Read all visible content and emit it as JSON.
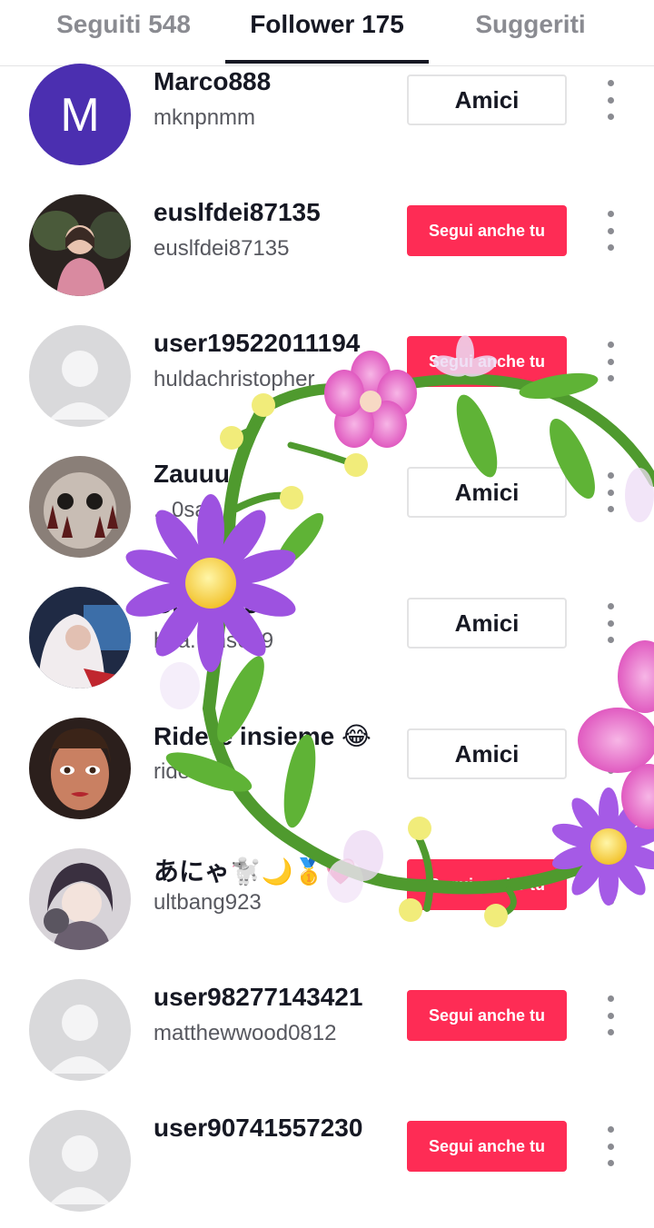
{
  "tabs": [
    {
      "label": "Seguiti 548"
    },
    {
      "label": "Follower 175"
    },
    {
      "label": "Suggeriti"
    }
  ],
  "followers": [
    {
      "name": "Marco888",
      "handle": "mknpnmm",
      "button": "Amici",
      "avatar_letter": "M"
    },
    {
      "name": "euslfdei87135",
      "handle": "euslfdei87135",
      "button": "Segui anche tu"
    },
    {
      "name": "user19522011194",
      "handle": "huldachristopher",
      "button": "Segui anche tu"
    },
    {
      "name": "Zauuu",
      "handle": "...0sa",
      "button": "Amici"
    },
    {
      "name": "Cr...e533",
      "handle": "hea...ms639",
      "button": "Amici"
    },
    {
      "name": "Ridere insieme 😂",
      "handle": "riderein",
      "button": "Amici"
    },
    {
      "name": "あにゃ🐩🌙🥇💗",
      "handle": "ultbang923",
      "button": "Segui anche tu"
    },
    {
      "name": "user98277143421",
      "handle": "matthewwood0812",
      "button": "Segui anche tu"
    },
    {
      "name": "user90741557230",
      "handle": "",
      "button": "Segui anche tu"
    }
  ],
  "colors": {
    "follow_button": "#fe2c55",
    "avatar_purple": "#4b2fb0",
    "placeholder_avatar": "#d9d9db"
  }
}
